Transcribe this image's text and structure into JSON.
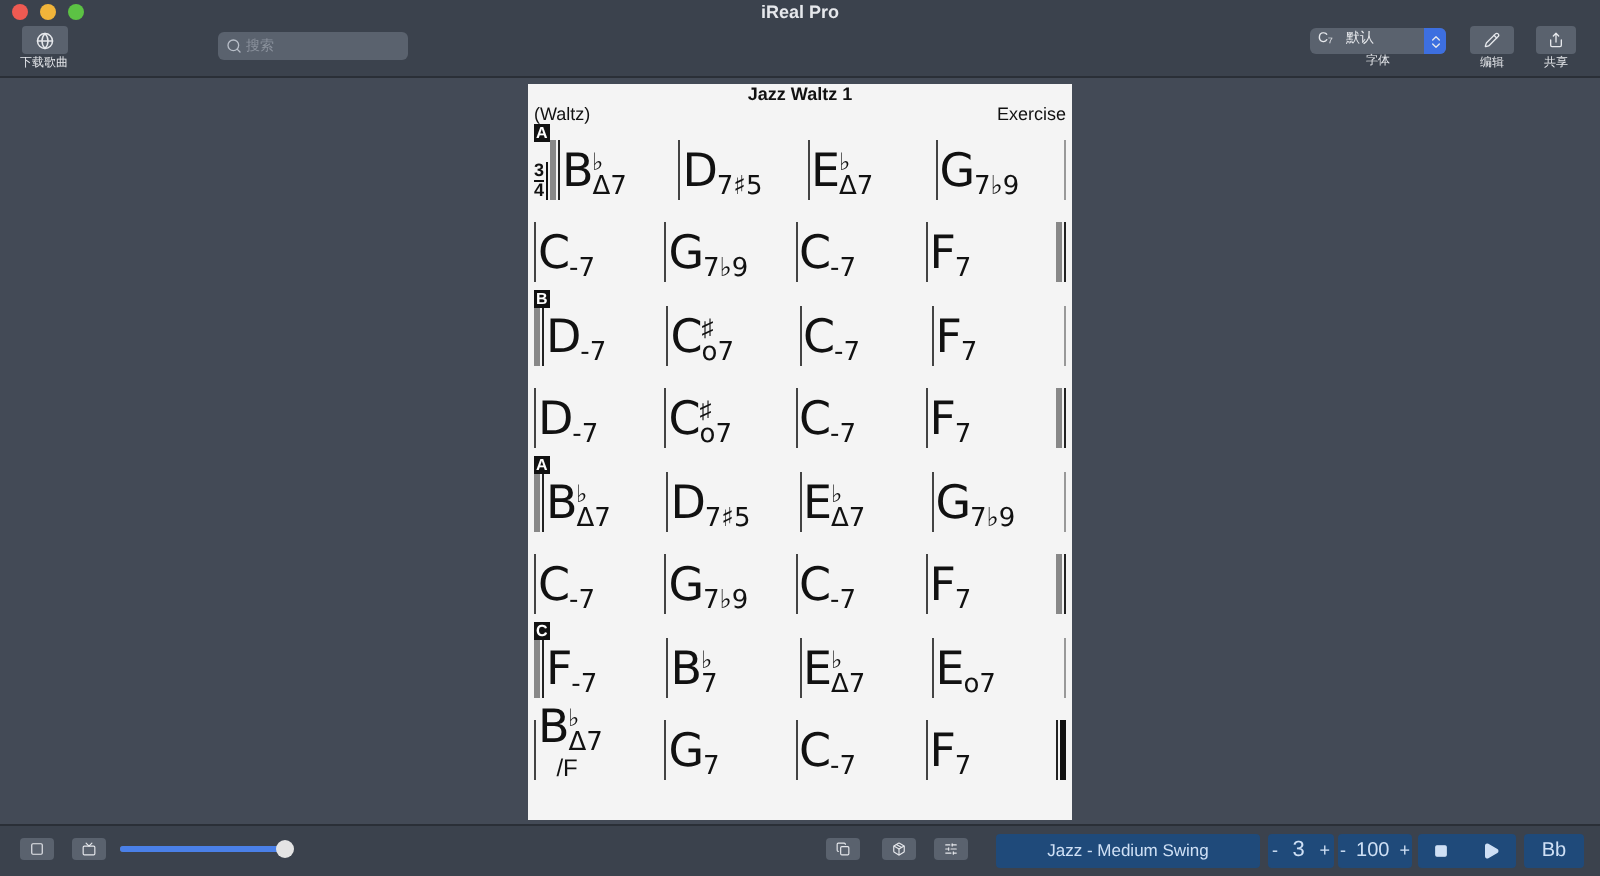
{
  "window": {
    "title": "iReal Pro"
  },
  "toolbar": {
    "download_label": "下载歌曲",
    "search": {
      "placeholder": "搜索"
    },
    "font_select": {
      "symbol": "C₇",
      "value": "默认",
      "label": "字体"
    },
    "edit_label": "编辑",
    "share_label": "共享"
  },
  "chart": {
    "title": "Jazz Waltz 1",
    "style": "(Waltz)",
    "composer": "Exercise",
    "rows": [
      {
        "section": "A",
        "time_signature": [
          "3",
          "4"
        ],
        "double_start": true,
        "double_end": false,
        "final": false,
        "measures": [
          {
            "root": "B",
            "accidental": "♭",
            "quality": "Δ7"
          },
          {
            "root": "D",
            "quality": "7♯5"
          },
          {
            "root": "E",
            "accidental": "♭",
            "quality": "Δ7"
          },
          {
            "root": "G",
            "quality": "7♭9"
          }
        ]
      },
      {
        "double_start": false,
        "double_end": true,
        "final": false,
        "measures": [
          {
            "root": "C",
            "quality": "-7"
          },
          {
            "root": "G",
            "quality": "7♭9"
          },
          {
            "root": "C",
            "quality": "-7"
          },
          {
            "root": "F",
            "quality": "7"
          }
        ]
      },
      {
        "section": "B",
        "double_start": true,
        "double_end": false,
        "final": false,
        "measures": [
          {
            "root": "D",
            "quality": "-7"
          },
          {
            "root": "C",
            "accidental": "♯",
            "quality": "o7"
          },
          {
            "root": "C",
            "quality": "-7"
          },
          {
            "root": "F",
            "quality": "7"
          }
        ]
      },
      {
        "double_start": false,
        "double_end": true,
        "final": false,
        "measures": [
          {
            "root": "D",
            "quality": "-7"
          },
          {
            "root": "C",
            "accidental": "♯",
            "quality": "o7"
          },
          {
            "root": "C",
            "quality": "-7"
          },
          {
            "root": "F",
            "quality": "7"
          }
        ]
      },
      {
        "section": "A",
        "double_start": true,
        "double_end": false,
        "final": false,
        "measures": [
          {
            "root": "B",
            "accidental": "♭",
            "quality": "Δ7"
          },
          {
            "root": "D",
            "quality": "7♯5"
          },
          {
            "root": "E",
            "accidental": "♭",
            "quality": "Δ7"
          },
          {
            "root": "G",
            "quality": "7♭9"
          }
        ]
      },
      {
        "double_start": false,
        "double_end": true,
        "final": false,
        "measures": [
          {
            "root": "C",
            "quality": "-7"
          },
          {
            "root": "G",
            "quality": "7♭9"
          },
          {
            "root": "C",
            "quality": "-7"
          },
          {
            "root": "F",
            "quality": "7"
          }
        ]
      },
      {
        "section": "C",
        "double_start": true,
        "double_end": false,
        "final": false,
        "measures": [
          {
            "root": "F",
            "quality": "-7"
          },
          {
            "root": "B",
            "accidental": "♭",
            "quality": "7"
          },
          {
            "root": "E",
            "accidental": "♭",
            "quality": "Δ7"
          },
          {
            "root": "E",
            "quality": "o7"
          }
        ]
      },
      {
        "double_start": false,
        "final": true,
        "measures": [
          {
            "root": "B",
            "accidental": "♭",
            "quality": "Δ7",
            "bass": "/F"
          },
          {
            "root": "G",
            "quality": "7"
          },
          {
            "root": "C",
            "quality": "-7"
          },
          {
            "root": "F",
            "quality": "7"
          }
        ]
      }
    ]
  },
  "bottom": {
    "volume": {
      "level": 0.97
    },
    "style": "Jazz - Medium Swing",
    "repeats": {
      "minus": "-",
      "value": "3",
      "plus": "+"
    },
    "tempo": {
      "minus": "-",
      "value": "100",
      "plus": "+"
    },
    "transpose": "Bb"
  }
}
